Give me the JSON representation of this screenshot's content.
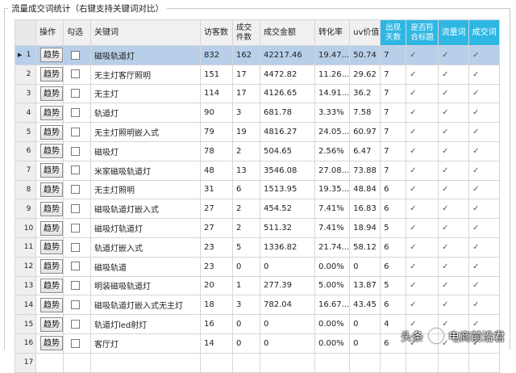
{
  "panel": {
    "title": "流量成交词统计（右键支持关键词对比）"
  },
  "columns": {
    "op": "操作",
    "check": "勾选",
    "keyword": "关键词",
    "visitors": "访客数",
    "orders_l1": "成交",
    "orders_l2": "件数",
    "amount": "成交金额",
    "conversion": "转化率",
    "uv": "uv价值",
    "days_l1": "出现",
    "days_l2": "天数",
    "match_l1": "是否符",
    "match_l2": "合标题",
    "traffic": "流量词",
    "deal": "成交词"
  },
  "trend_label": "趋势",
  "tick": "✓",
  "colors": {
    "header_highlight": "#2fb7e4",
    "selected_row": "#b7cfe9"
  },
  "rows": [
    {
      "n": "1",
      "kw": "磁吸轨道灯",
      "v": "832",
      "o": "162",
      "a": "42217.46",
      "c": "19.47...",
      "u": "50.74",
      "d": "7",
      "m": "✓",
      "t": "✓",
      "s": "✓"
    },
    {
      "n": "2",
      "kw": "无主灯客厅照明",
      "v": "151",
      "o": "17",
      "a": "4472.82",
      "c": "11.26...",
      "u": "29.62",
      "d": "7",
      "m": "✓",
      "t": "✓",
      "s": "✓"
    },
    {
      "n": "3",
      "kw": "无主灯",
      "v": "114",
      "o": "17",
      "a": "4126.65",
      "c": "14.91...",
      "u": "36.2",
      "d": "7",
      "m": "✓",
      "t": "✓",
      "s": "✓"
    },
    {
      "n": "4",
      "kw": "轨道灯",
      "v": "90",
      "o": "3",
      "a": "681.78",
      "c": "3.33%",
      "u": "7.58",
      "d": "7",
      "m": "✓",
      "t": "✓",
      "s": "✓"
    },
    {
      "n": "5",
      "kw": "无主灯照明嵌入式",
      "v": "79",
      "o": "19",
      "a": "4816.27",
      "c": "24.05...",
      "u": "60.97",
      "d": "7",
      "m": "✓",
      "t": "✓",
      "s": "✓"
    },
    {
      "n": "6",
      "kw": "磁吸灯",
      "v": "78",
      "o": "2",
      "a": "504.65",
      "c": "2.56%",
      "u": "6.47",
      "d": "7",
      "m": "✓",
      "t": "✓",
      "s": "✓"
    },
    {
      "n": "7",
      "kw": "米家磁吸轨道灯",
      "v": "48",
      "o": "13",
      "a": "3546.08",
      "c": "27.08...",
      "u": "73.88",
      "d": "7",
      "m": "✓",
      "t": "✓",
      "s": "✓"
    },
    {
      "n": "8",
      "kw": "无主灯照明",
      "v": "31",
      "o": "6",
      "a": "1513.95",
      "c": "19.35...",
      "u": "48.84",
      "d": "6",
      "m": "✓",
      "t": "✓",
      "s": "✓"
    },
    {
      "n": "9",
      "kw": "磁吸轨道灯嵌入式",
      "v": "27",
      "o": "2",
      "a": "454.52",
      "c": "7.41%",
      "u": "16.83",
      "d": "6",
      "m": "✓",
      "t": "✓",
      "s": "✓"
    },
    {
      "n": "10",
      "kw": "磁吸灯轨道灯",
      "v": "27",
      "o": "2",
      "a": "511.32",
      "c": "7.41%",
      "u": "18.94",
      "d": "5",
      "m": "✓",
      "t": "✓",
      "s": "✓"
    },
    {
      "n": "11",
      "kw": "轨道灯嵌入式",
      "v": "23",
      "o": "5",
      "a": "1336.82",
      "c": "21.74...",
      "u": "58.12",
      "d": "6",
      "m": "✓",
      "t": "✓",
      "s": "✓"
    },
    {
      "n": "12",
      "kw": "磁吸轨道",
      "v": "23",
      "o": "0",
      "a": "0",
      "c": "0.00%",
      "u": "0",
      "d": "6",
      "m": "✓",
      "t": "✓",
      "s": "✓"
    },
    {
      "n": "13",
      "kw": "明装磁吸轨道灯",
      "v": "20",
      "o": "1",
      "a": "277.39",
      "c": "5.00%",
      "u": "13.87",
      "d": "5",
      "m": "✓",
      "t": "✓",
      "s": "✓"
    },
    {
      "n": "14",
      "kw": "磁吸轨道灯嵌入式无主灯",
      "v": "18",
      "o": "3",
      "a": "782.04",
      "c": "16.67...",
      "u": "43.45",
      "d": "6",
      "m": "✓",
      "t": "✓",
      "s": "✓"
    },
    {
      "n": "15",
      "kw": "轨道灯led射灯",
      "v": "16",
      "o": "0",
      "a": "0",
      "c": "0.00%",
      "u": "0",
      "d": "4",
      "m": "✓",
      "t": "✓",
      "s": "✓"
    },
    {
      "n": "16",
      "kw": "客厅灯",
      "v": "14",
      "o": "0",
      "a": "0",
      "c": "0.00%",
      "u": "0",
      "d": "6",
      "m": "✓",
      "t": "✓",
      "s": "✓"
    },
    {
      "n": "17",
      "kw": "",
      "v": "",
      "o": "",
      "a": "",
      "c": "",
      "u": "",
      "d": "",
      "m": "",
      "t": "",
      "s": ""
    }
  ],
  "watermark": {
    "prefix": "头条",
    "text": "电商前沿君"
  }
}
